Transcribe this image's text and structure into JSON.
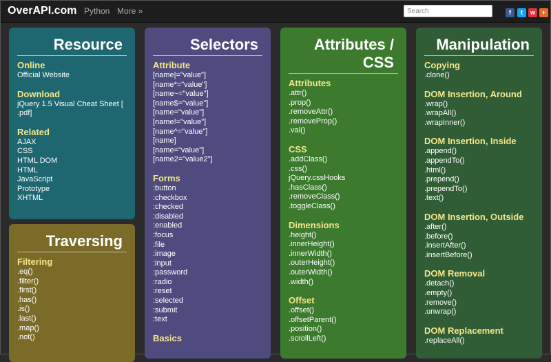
{
  "header": {
    "logo": "OverAPI.com",
    "nav": [
      "Python",
      "More »"
    ],
    "search_placeholder": "Search",
    "social": [
      {
        "name": "facebook-icon",
        "glyph": "f",
        "color": "#3b5998"
      },
      {
        "name": "twitter-icon",
        "glyph": "t",
        "color": "#1da1f2"
      },
      {
        "name": "weibo-icon",
        "glyph": "w",
        "color": "#e0333a"
      },
      {
        "name": "plus-icon",
        "glyph": "+",
        "color": "#e66a2c"
      }
    ]
  },
  "cards": [
    {
      "id": "resource",
      "title": "Resource",
      "color": "#1f6770",
      "sections": [
        {
          "title": "Online",
          "items": [
            "Official Website"
          ]
        },
        {
          "title": "Download",
          "items": [
            "jQuery 1.5 Visual Cheat Sheet [ .pdf]"
          ]
        },
        {
          "title": "Related",
          "items": [
            "AJAX",
            "CSS",
            "HTML DOM",
            "HTML",
            "JavaScript",
            "Prototype",
            "XHTML"
          ]
        }
      ]
    },
    {
      "id": "traversing",
      "title": "Traversing",
      "color": "#7a6c28",
      "sections": [
        {
          "title": "Filtering",
          "items": [
            ".eq()",
            ".filter()",
            ".first()",
            ".has()",
            ".is()",
            ".last()",
            ".map()",
            ".not()"
          ]
        }
      ]
    },
    {
      "id": "selectors",
      "title": "Selectors",
      "color": "#4f4b7f",
      "sections": [
        {
          "title": "Attribute",
          "items": [
            "[name|=\"value\"]",
            "[name*=\"value\"]",
            "[name~=\"value\"]",
            "[name$=\"value\"]",
            "[name=\"value\"]",
            "[name!=\"value\"]",
            "[name^=\"value\"]",
            "[name]",
            "[name=\"value\"][name2=\"value2\"]"
          ]
        },
        {
          "title": "Forms",
          "items": [
            ":button",
            ":checkbox",
            ":checked",
            ":disabled",
            ":enabled",
            ":focus",
            ":file",
            ":image",
            ":input",
            ":password",
            ":radio",
            ":reset",
            ":selected",
            ":submit",
            ":text"
          ]
        },
        {
          "title": "Basics",
          "items": []
        }
      ]
    },
    {
      "id": "attributes-css",
      "title": "Attributes / CSS",
      "color": "#3c7a2e",
      "sections": [
        {
          "title": "Attributes",
          "items": [
            ".attr()",
            ".prop()",
            ".removeAttr()",
            ".removeProp()",
            ".val()"
          ]
        },
        {
          "title": "CSS",
          "items": [
            ".addClass()",
            ".css()",
            "jQuery.cssHooks",
            ".hasClass()",
            ".removeClass()",
            ".toggleClass()"
          ]
        },
        {
          "title": "Dimensions",
          "items": [
            ".height()",
            ".innerHeight()",
            ".innerWidth()",
            ".outerHeight()",
            ".outerWidth()",
            ".width()"
          ]
        },
        {
          "title": "Offset",
          "items": [
            ".offset()",
            ".offsetParent()",
            ".position()",
            ".scrollLeft()"
          ]
        }
      ]
    },
    {
      "id": "manipulation",
      "title": "Manipulation",
      "color": "#305c36",
      "sections": [
        {
          "title": "Copying",
          "items": [
            ".clone()"
          ]
        },
        {
          "title": "DOM Insertion, Around",
          "items": [
            ".wrap()",
            ".wrapAll()",
            ".wrapInner()"
          ]
        },
        {
          "title": "DOM Insertion, Inside",
          "items": [
            ".append()",
            ".appendTo()",
            ".html()",
            ".prepend()",
            ".prependTo()",
            ".text()"
          ]
        },
        {
          "title": "DOM Insertion, Outside",
          "items": [
            ".after()",
            ".before()",
            ".insertAfter()",
            ".insertBefore()"
          ]
        },
        {
          "title": "DOM Removal",
          "items": [
            ".detach()",
            ".empty()",
            ".remove()",
            ".unwrap()"
          ]
        },
        {
          "title": "DOM Replacement",
          "items": [
            ".replaceAll()"
          ]
        }
      ]
    }
  ]
}
